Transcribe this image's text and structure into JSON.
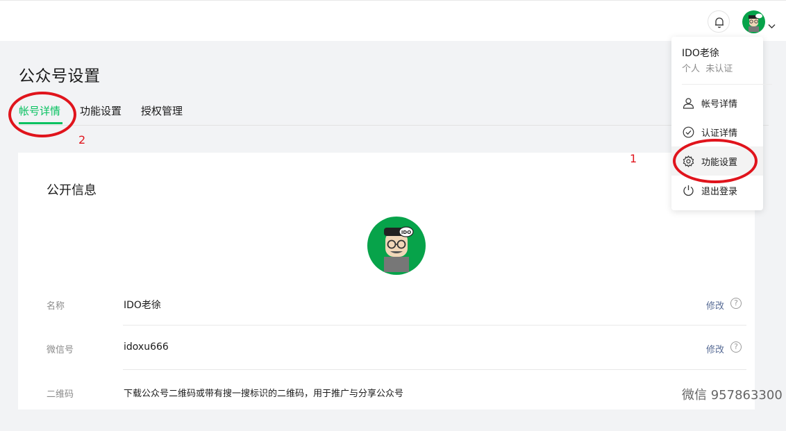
{
  "header": {
    "notifications_icon": "bell-icon",
    "avatar_icon": "avatar-icon",
    "menu_chevron_icon": "chevron-down-icon"
  },
  "page": {
    "title": "公众号设置",
    "tabs": [
      {
        "label": "帐号详情",
        "active": true
      },
      {
        "label": "功能设置",
        "active": false
      },
      {
        "label": "授权管理",
        "active": false
      }
    ]
  },
  "card": {
    "title": "公开信息",
    "rows": [
      {
        "label": "名称",
        "value": "IDO老徐",
        "action": "修改"
      },
      {
        "label": "微信号",
        "value": "idoxu666",
        "action": "修改"
      },
      {
        "label": "二维码",
        "value": "下载公众号二维码或带有搜一搜标识的二维码，用于推广与分享公众号",
        "action": ""
      }
    ]
  },
  "dropdown": {
    "name": "IDO老徐",
    "type": "个人",
    "verify": "未认证",
    "items": [
      {
        "label": "帐号详情",
        "icon": "user-icon"
      },
      {
        "label": "认证详情",
        "icon": "check-circle-icon"
      },
      {
        "label": "功能设置",
        "icon": "gear-icon"
      },
      {
        "label": "退出登录",
        "icon": "power-icon"
      }
    ]
  },
  "annotations": {
    "num1": "1",
    "num2": "2",
    "color": "#e0141c"
  },
  "watermark": "微信 957863300",
  "colors": {
    "accent": "#07c160",
    "link": "#576b95"
  }
}
